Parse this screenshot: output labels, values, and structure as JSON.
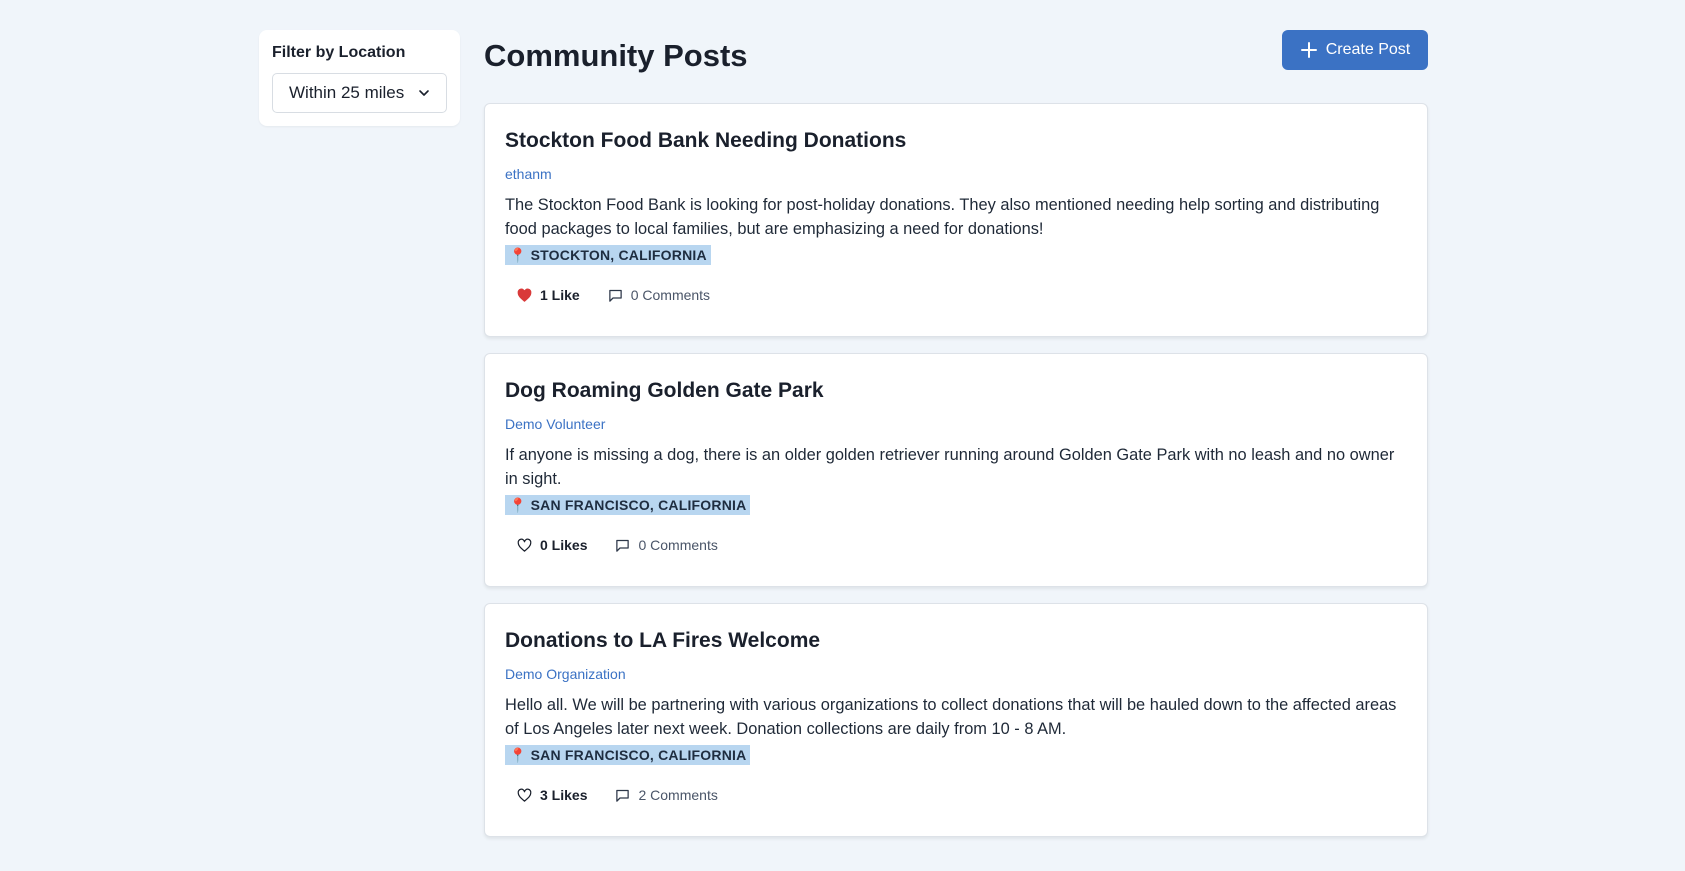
{
  "sidebar": {
    "title": "Filter by Location",
    "filter_value": "Within 25 miles"
  },
  "header": {
    "title": "Community Posts",
    "create_label": "Create Post"
  },
  "posts": [
    {
      "title": "Stockton Food Bank Needing Donations",
      "author": "ethanm",
      "body": "The Stockton Food Bank is looking for post-holiday donations. They also mentioned needing help sorting and distributing food packages to local families, but are emphasizing a need for donations!",
      "location": "STOCKTON, CALIFORNIA",
      "likes": "1 Like",
      "liked": true,
      "comments": "0 Comments"
    },
    {
      "title": "Dog Roaming Golden Gate Park",
      "author": "Demo Volunteer",
      "body": "If anyone is missing a dog, there is an older golden retriever running around Golden Gate Park with no leash and no owner in sight.",
      "location": "SAN FRANCISCO, CALIFORNIA",
      "likes": "0 Likes",
      "liked": false,
      "comments": "0 Comments"
    },
    {
      "title": "Donations to LA Fires Welcome",
      "author": "Demo Organization",
      "body": "Hello all. We will be partnering with various organizations to collect donations that will be hauled down to the affected areas of Los Angeles later next week. Donation collections are daily from 10 - 8 AM.",
      "location": "SAN FRANCISCO, CALIFORNIA",
      "likes": "3 Likes",
      "liked": false,
      "comments": "2 Comments"
    }
  ],
  "colors": {
    "accent": "#3b72c4",
    "background": "#f0f5fa",
    "location_badge": "#b8d6f0",
    "liked_heart": "#d93a3a"
  },
  "icons": {
    "plus": "plus-icon",
    "chevron": "chevron-down-icon",
    "pin": "map-pin-icon",
    "heart": "heart-icon",
    "comment": "comment-icon"
  }
}
